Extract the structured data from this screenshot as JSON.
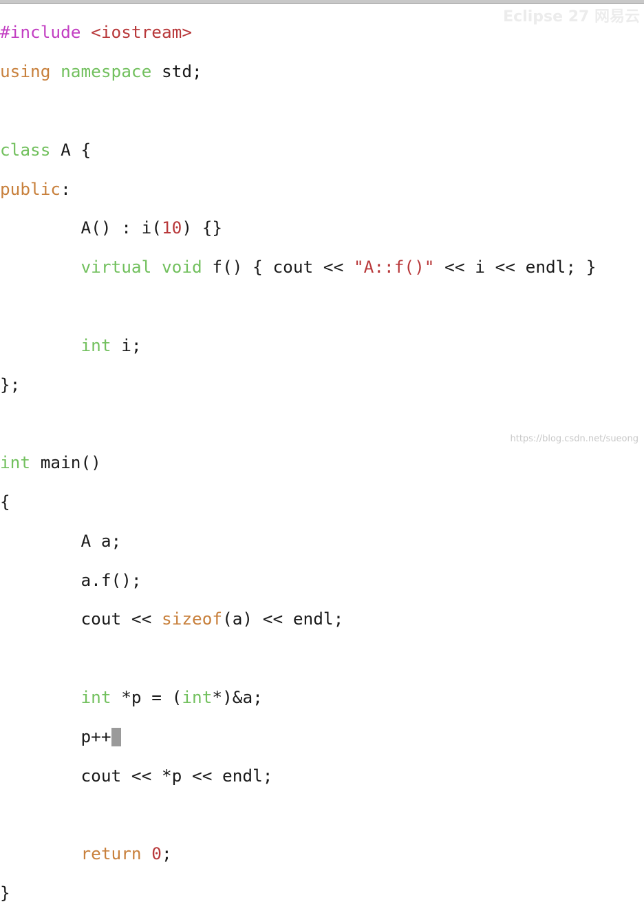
{
  "watermark_top": "Eclipse 27 网易云",
  "watermark_bottom": "https://blog.csdn.net/sueong",
  "code": {
    "l1a": "#include",
    "l1b": " <iostream>",
    "l2a": "using",
    "l2b": " namespace",
    "l2c": " std;",
    "l4a": "class",
    "l4b": " A {",
    "l5a": "public",
    "l5b": ":",
    "l6a": "        A() : i(",
    "l6b": "10",
    "l6c": ") {}",
    "l7a": "        virtual void",
    "l7b": " f() { cout << ",
    "l7c": "\"A::f()\"",
    "l7d": " << i << endl; }",
    "l9a": "        int",
    "l9b": " i;",
    "l10": "};",
    "l12a": "int",
    "l12b": " main()",
    "l13": "{",
    "l14": "        A a;",
    "l15": "        a.f();",
    "l16a": "        cout << ",
    "l16b": "sizeof",
    "l16c": "(a) << endl;",
    "l18a": "        int",
    "l18b": " *p = (",
    "l18c": "int",
    "l18d": "*)&a;",
    "l19": "        p++",
    "l20": "        cout << *p << endl;",
    "l22a": "        return",
    "l22b": " ",
    "l22c": "0",
    "l22d": ";",
    "l23": "}"
  }
}
